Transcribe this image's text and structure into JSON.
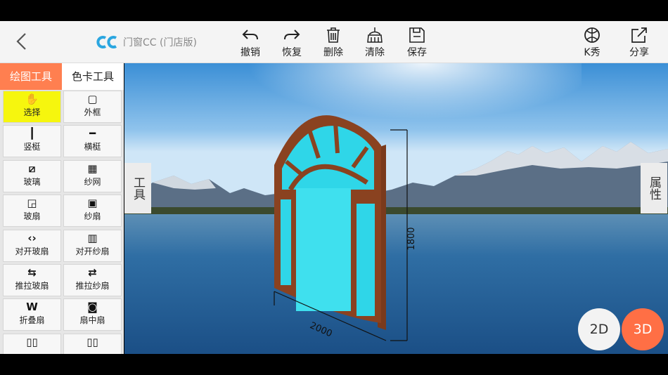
{
  "header": {
    "app_name": "门窗CC (门店版)",
    "toolbar": [
      {
        "label": "撤销",
        "icon": "undo-icon"
      },
      {
        "label": "恢复",
        "icon": "redo-icon"
      },
      {
        "label": "删除",
        "icon": "trash-icon"
      },
      {
        "label": "清除",
        "icon": "broom-icon"
      },
      {
        "label": "保存",
        "icon": "save-icon"
      }
    ],
    "right": [
      {
        "label": "K秀",
        "icon": "kshow-icon"
      },
      {
        "label": "分享",
        "icon": "share-icon"
      }
    ]
  },
  "tabs": {
    "drawing": "绘图工具",
    "color": "色卡工具"
  },
  "tools": [
    {
      "label": "选择",
      "icon": "hand-icon",
      "glyph": "✋"
    },
    {
      "label": "外框",
      "icon": "frame-icon",
      "glyph": "▢"
    },
    {
      "label": "竖梃",
      "icon": "vertical-mullion-icon",
      "glyph": "┃"
    },
    {
      "label": "横梃",
      "icon": "horizontal-mullion-icon",
      "glyph": "━"
    },
    {
      "label": "玻璃",
      "icon": "glass-icon",
      "glyph": "⧄"
    },
    {
      "label": "纱网",
      "icon": "mesh-icon",
      "glyph": "▦"
    },
    {
      "label": "玻扇",
      "icon": "glass-sash-icon",
      "glyph": "◲"
    },
    {
      "label": "纱扇",
      "icon": "screen-sash-icon",
      "glyph": "▣"
    },
    {
      "label": "对开玻扇",
      "icon": "double-glass-sash-icon",
      "glyph": "‹›"
    },
    {
      "label": "对开纱扇",
      "icon": "double-screen-sash-icon",
      "glyph": "▥"
    },
    {
      "label": "推拉玻扇",
      "icon": "sliding-glass-sash-icon",
      "glyph": "⇆"
    },
    {
      "label": "推拉纱扇",
      "icon": "sliding-screen-sash-icon",
      "glyph": "⇄"
    },
    {
      "label": "折叠扇",
      "icon": "folding-sash-icon",
      "glyph": "W"
    },
    {
      "label": "扇中扇",
      "icon": "sash-in-sash-icon",
      "glyph": "◙"
    },
    {
      "label": "",
      "icon": "double-panel-icon",
      "glyph": "▯▯"
    },
    {
      "label": "",
      "icon": "double-panel-icon",
      "glyph": "▯▯"
    }
  ],
  "side": {
    "tools": "工具",
    "props": "属性"
  },
  "dims": {
    "width": "2000",
    "height": "1800"
  },
  "view": {
    "d2": "2D",
    "d3": "3D"
  },
  "colors": {
    "accent": "#ff7f50",
    "active": "#f6f60e",
    "frame": "#9b4a24",
    "glass": "#2fd6e8"
  }
}
